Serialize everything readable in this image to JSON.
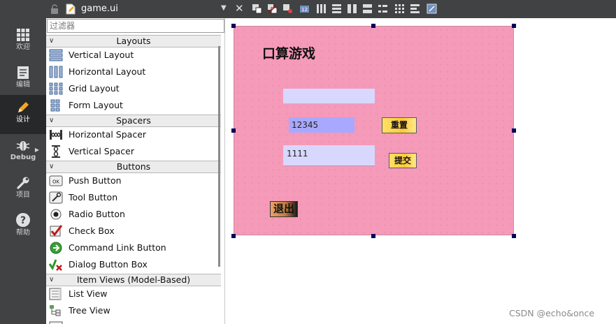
{
  "modes": [
    {
      "label": "欢迎",
      "icon": "grid-icon"
    },
    {
      "label": "编辑",
      "icon": "document-icon"
    },
    {
      "label": "设计",
      "icon": "pencil-icon",
      "active": true
    },
    {
      "label": "Debug",
      "icon": "bug-icon"
    },
    {
      "label": "项目",
      "icon": "wrench-icon"
    },
    {
      "label": "帮助",
      "icon": "help-icon"
    }
  ],
  "editor": {
    "file_name": "game.ui"
  },
  "widget_box": {
    "filter_placeholder": "过滤器",
    "categories": {
      "layouts": "Layouts",
      "spacers": "Spacers",
      "buttons": "Buttons",
      "item_views": "Item Views (Model-Based)"
    },
    "items": {
      "vertical_layout": "Vertical Layout",
      "horizontal_layout": "Horizontal Layout",
      "grid_layout": "Grid Layout",
      "form_layout": "Form Layout",
      "horizontal_spacer": "Horizontal Spacer",
      "vertical_spacer": "Vertical Spacer",
      "push_button": "Push Button",
      "tool_button": "Tool Button",
      "radio_button": "Radio Button",
      "check_box": "Check Box",
      "command_link_button": "Command Link Button",
      "dialog_button_box": "Dialog Button Box",
      "list_view": "List View",
      "tree_view": "Tree View"
    }
  },
  "form": {
    "title": "口算游戏",
    "number_display": "12345",
    "answer_value": "1111",
    "reset_label": "重置",
    "submit_label": "提交",
    "quit_label": "退出"
  },
  "watermark": "CSDN @echo&once",
  "colors": {
    "form_background": "#f59ab8",
    "input_background": "#d8d8ff",
    "number_background": "#a8a8ff",
    "button_yellow": "#ffca3a"
  }
}
